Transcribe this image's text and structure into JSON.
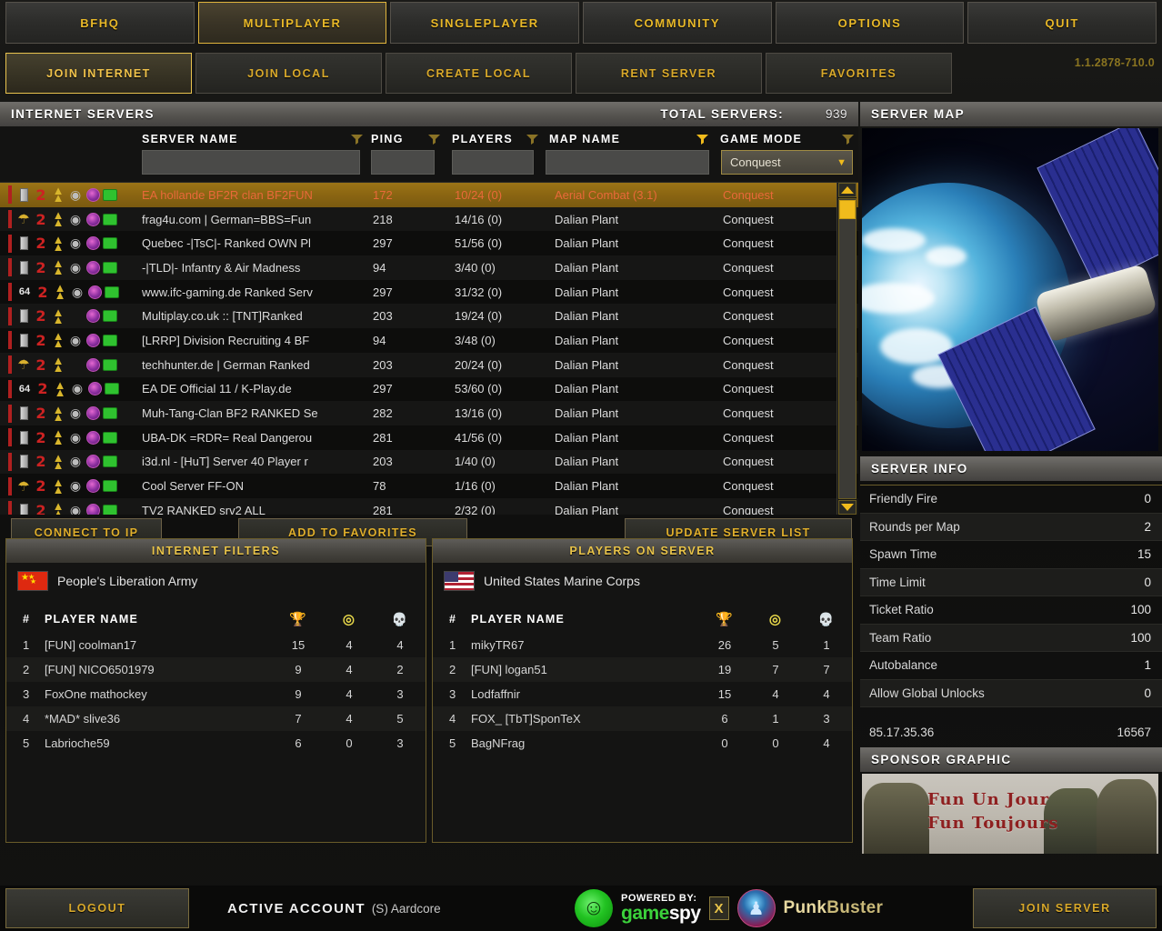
{
  "top_nav": {
    "items": [
      {
        "label": "BFHQ",
        "selected": false
      },
      {
        "label": "MULTIPLAYER",
        "selected": true
      },
      {
        "label": "SINGLEPLAYER",
        "selected": false
      },
      {
        "label": "COMMUNITY",
        "selected": false
      },
      {
        "label": "OPTIONS",
        "selected": false
      },
      {
        "label": "QUIT",
        "selected": false
      }
    ]
  },
  "sub_nav": {
    "items": [
      {
        "label": "JOIN INTERNET",
        "selected": true
      },
      {
        "label": "JOIN LOCAL",
        "selected": false
      },
      {
        "label": "CREATE LOCAL",
        "selected": false
      },
      {
        "label": "RENT SERVER",
        "selected": false
      },
      {
        "label": "FAVORITES",
        "selected": false
      }
    ],
    "version": "1.1.2878-710.0"
  },
  "server_list": {
    "panel_title": "INTERNET SERVERS",
    "total_label": "TOTAL SERVERS:",
    "total_count": "939",
    "columns": {
      "server_name": "SERVER NAME",
      "ping": "PING",
      "players": "PLAYERS",
      "map_name": "MAP NAME",
      "game_mode": "GAME MODE"
    },
    "filters": {
      "server_name_value": "",
      "ping_value": "",
      "players_value": "",
      "map_name_value": "",
      "game_mode_value": "Conquest"
    },
    "rows": [
      {
        "slots": "bar",
        "name": "EA hollande BF2R clan BF2FUN",
        "ping": "172",
        "players": "10/24 (0)",
        "map": "Aerial Combat (3.1)",
        "mode": "Conquest",
        "selected": true,
        "headset": true
      },
      {
        "slots": "bell",
        "name": "frag4u.com | German=BBS=Fun",
        "ping": "218",
        "players": "14/16 (0)",
        "map": "Dalian Plant",
        "mode": "Conquest",
        "selected": false,
        "headset": true
      },
      {
        "slots": "bar",
        "name": "Quebec -|TsC|- Ranked OWN Pl",
        "ping": "297",
        "players": "51/56 (0)",
        "map": "Dalian Plant",
        "mode": "Conquest",
        "selected": false,
        "headset": true
      },
      {
        "slots": "bar",
        "name": "-|TLD|- Infantry & Air Madness",
        "ping": "94",
        "players": "3/40 (0)",
        "map": "Dalian Plant",
        "mode": "Conquest",
        "selected": false,
        "headset": true
      },
      {
        "slots": "64",
        "name": "www.ifc-gaming.de Ranked Serv",
        "ping": "297",
        "players": "31/32 (0)",
        "map": "Dalian Plant",
        "mode": "Conquest",
        "selected": false,
        "headset": true
      },
      {
        "slots": "bar",
        "name": "Multiplay.co.uk :: [TNT]Ranked",
        "ping": "203",
        "players": "19/24 (0)",
        "map": "Dalian Plant",
        "mode": "Conquest",
        "selected": false,
        "headset": false
      },
      {
        "slots": "bar",
        "name": "[LRRP] Division Recruiting 4 BF",
        "ping": "94",
        "players": "3/48 (0)",
        "map": "Dalian Plant",
        "mode": "Conquest",
        "selected": false,
        "headset": true
      },
      {
        "slots": "bell",
        "name": "techhunter.de | German Ranked",
        "ping": "203",
        "players": "20/24 (0)",
        "map": "Dalian Plant",
        "mode": "Conquest",
        "selected": false,
        "headset": false
      },
      {
        "slots": "64",
        "name": "EA DE Official 11 / K-Play.de",
        "ping": "297",
        "players": "53/60 (0)",
        "map": "Dalian Plant",
        "mode": "Conquest",
        "selected": false,
        "headset": true
      },
      {
        "slots": "bar",
        "name": "Muh-Tang-Clan BF2 RANKED Se",
        "ping": "282",
        "players": "13/16 (0)",
        "map": "Dalian Plant",
        "mode": "Conquest",
        "selected": false,
        "headset": true
      },
      {
        "slots": "bar",
        "name": "UBA-DK =RDR= Real Dangerou",
        "ping": "281",
        "players": "41/56 (0)",
        "map": "Dalian Plant",
        "mode": "Conquest",
        "selected": false,
        "headset": true
      },
      {
        "slots": "bar",
        "name": "i3d.nl - [HuT] Server 40 Player r",
        "ping": "203",
        "players": "1/40 (0)",
        "map": "Dalian Plant",
        "mode": "Conquest",
        "selected": false,
        "headset": true
      },
      {
        "slots": "bell",
        "name": "Cool Server FF-ON",
        "ping": "78",
        "players": "1/16 (0)",
        "map": "Dalian Plant",
        "mode": "Conquest",
        "selected": false,
        "headset": true
      },
      {
        "slots": "bar",
        "name": "TV2 RANKED srv2 ALL",
        "ping": "281",
        "players": "2/32 (0)",
        "map": "Dalian Plant",
        "mode": "Conquest",
        "selected": false,
        "headset": true
      }
    ]
  },
  "actions": {
    "connect_to_ip": "CONNECT TO IP",
    "add_to_favorites": "ADD TO FAVORITES",
    "update_server_list": "UPDATE SERVER LIST"
  },
  "filters_panel": {
    "title": "INTERNET FILTERS",
    "team_name": "People's Liberation Army",
    "columns": {
      "num": "#",
      "player_name": "PLAYER NAME"
    },
    "players": [
      {
        "num": "1",
        "name": "[FUN] coolman17",
        "score": "15",
        "kills": "4",
        "deaths": "4"
      },
      {
        "num": "2",
        "name": "[FUN] NICO6501979",
        "score": "9",
        "kills": "4",
        "deaths": "2"
      },
      {
        "num": "3",
        "name": "FoxOne mathockey",
        "score": "9",
        "kills": "4",
        "deaths": "3"
      },
      {
        "num": "4",
        "name": "*MAD* slive36",
        "score": "7",
        "kills": "4",
        "deaths": "5"
      },
      {
        "num": "5",
        "name": "Labrioche59",
        "score": "6",
        "kills": "0",
        "deaths": "3"
      }
    ]
  },
  "players_panel": {
    "title": "PLAYERS ON SERVER",
    "team_name": "United States Marine Corps",
    "columns": {
      "num": "#",
      "player_name": "PLAYER NAME"
    },
    "players": [
      {
        "num": "1",
        "name": "mikyTR67",
        "score": "26",
        "kills": "5",
        "deaths": "1"
      },
      {
        "num": "2",
        "name": "[FUN] logan51",
        "score": "19",
        "kills": "7",
        "deaths": "7"
      },
      {
        "num": "3",
        "name": "Lodfaffnir",
        "score": "15",
        "kills": "4",
        "deaths": "4"
      },
      {
        "num": "4",
        "name": "FOX_ [TbT]SponTeX",
        "score": "6",
        "kills": "1",
        "deaths": "3"
      },
      {
        "num": "5",
        "name": "BagNFrag",
        "score": "0",
        "kills": "0",
        "deaths": "4"
      }
    ]
  },
  "server_map": {
    "title": "SERVER MAP"
  },
  "server_info": {
    "title": "SERVER INFO",
    "rows": [
      {
        "label": "Friendly Fire",
        "value": "0"
      },
      {
        "label": "Rounds per Map",
        "value": "2"
      },
      {
        "label": "Spawn Time",
        "value": "15"
      },
      {
        "label": "Time Limit",
        "value": "0"
      },
      {
        "label": "Ticket Ratio",
        "value": "100"
      },
      {
        "label": "Team Ratio",
        "value": "100"
      },
      {
        "label": "Autobalance",
        "value": "1"
      },
      {
        "label": "Allow Global Unlocks",
        "value": "0"
      }
    ],
    "address": "85.17.35.36",
    "port": "16567"
  },
  "sponsor": {
    "title": "SPONSOR GRAPHIC",
    "line1": "Fun Un Jour",
    "line2": "Fun Toujours"
  },
  "footer": {
    "logout": "LOGOUT",
    "active_account_label": "ACTIVE ACCOUNT",
    "active_account_value": "(S) Aardcore",
    "gamespy_powered": "POWERED BY:",
    "gamespy_game": "game",
    "gamespy_spy": "spy",
    "x_label": "X",
    "punkbuster_a": "Punk",
    "punkbuster_b": "Buster",
    "join_server": "JOIN SERVER"
  },
  "colors": {
    "gold": "#e8b828",
    "selected_row_bg": "#9b7416",
    "selected_row_text": "#e8693a",
    "red_bar": "#b02020",
    "green_monitor": "#2fc22f"
  }
}
